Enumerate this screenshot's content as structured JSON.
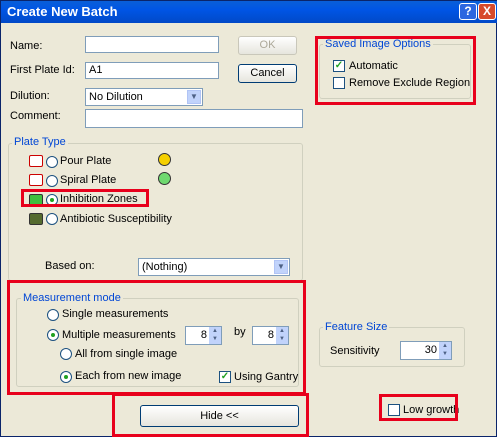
{
  "window": {
    "title": "Create New Batch",
    "help": "?",
    "close": "X"
  },
  "form": {
    "name_label": "Name:",
    "name_value": "",
    "first_plate_label": "First Plate Id:",
    "first_plate_value": "A1",
    "dilution_label": "Dilution:",
    "dilution_value": "No Dilution",
    "comment_label": "Comment:",
    "comment_value": "",
    "ok_label": "OK",
    "cancel_label": "Cancel"
  },
  "saved_image": {
    "title": "Saved Image Options",
    "automatic": "Automatic",
    "remove_exclude": "Remove Exclude Region"
  },
  "plate_type": {
    "title": "Plate Type",
    "pour": "Pour Plate",
    "spiral": "Spiral Plate",
    "inhibition": "Inhibition Zones",
    "antibiotic": "Antibiotic Susceptibility",
    "based_on_label": "Based on:",
    "based_on_value": "(Nothing)"
  },
  "measurement": {
    "title": "Measurement mode",
    "single": "Single measurements",
    "multiple": "Multiple measurements",
    "count1": "8",
    "by": "by",
    "count2": "8",
    "all_single": "All from single image",
    "each_new": "Each from new image",
    "gantry": "Using Gantry"
  },
  "feature": {
    "title": "Feature Size",
    "sensitivity_label": "Sensitivity",
    "sensitivity_value": "30",
    "low_growth": "Low growth"
  },
  "hide_label": "Hide <<"
}
